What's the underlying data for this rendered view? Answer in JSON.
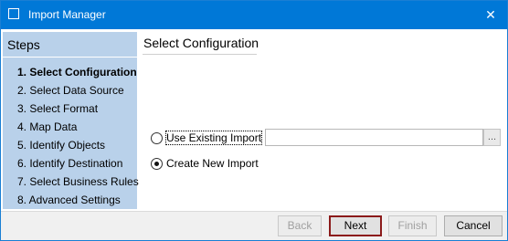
{
  "window": {
    "title": "Import Manager",
    "close_glyph": "✕"
  },
  "steps": {
    "heading": "Steps",
    "items": [
      {
        "label": "1. Select Configuration",
        "active": true
      },
      {
        "label": "2. Select Data Source",
        "active": false
      },
      {
        "label": "3. Select Format",
        "active": false
      },
      {
        "label": "4. Map Data",
        "active": false
      },
      {
        "label": "5. Identify Objects",
        "active": false
      },
      {
        "label": "6. Identify Destination",
        "active": false
      },
      {
        "label": "7. Select Business Rules",
        "active": false
      },
      {
        "label": "8. Advanced Settings",
        "active": false
      }
    ]
  },
  "page": {
    "title": "Select Configuration"
  },
  "options": {
    "use_existing_label": "Use Existing Import",
    "use_existing_selected": false,
    "create_new_label": "Create New Import",
    "create_new_selected": true,
    "existing_import_value": "",
    "browse_label": "..."
  },
  "buttons": {
    "back": "Back",
    "next": "Next",
    "finish": "Finish",
    "cancel": "Cancel"
  },
  "colors": {
    "titlebar": "#0078d7",
    "steps_panel": "#b9d1ea",
    "default_button_border": "#8b1a1a"
  },
  "icons": {
    "window_icon": "window-icon",
    "close_icon": "close-icon"
  }
}
